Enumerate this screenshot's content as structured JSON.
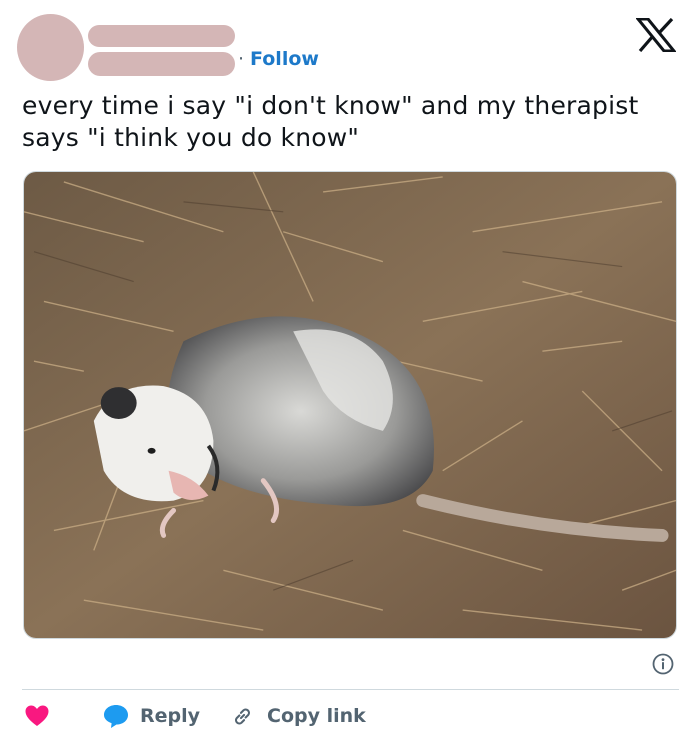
{
  "post": {
    "follow_separator": "·",
    "follow_label": "Follow",
    "text_line1": "every time i say \"i don't know\" and my therapist",
    "text_line2": "says \"i think you do know\"",
    "brand_icon": "x-logo-icon",
    "image_subject": "opossum"
  },
  "actions": {
    "like_icon": "heart-icon",
    "reply_label": "Reply",
    "copy_link_label": "Copy link"
  },
  "colors": {
    "placeholder": "#d4b6b6",
    "follow": "#1d79c9",
    "heart": "#f91880",
    "reply_icon": "#1d9bf0",
    "muted": "#536471"
  }
}
